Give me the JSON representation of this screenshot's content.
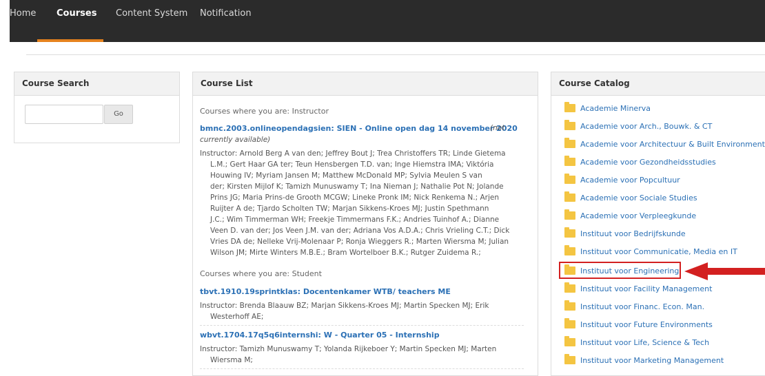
{
  "nav": {
    "items": [
      "Home",
      "Courses",
      "Content System",
      "Notification"
    ],
    "active": "Courses",
    "accent": "#e5821e"
  },
  "search_panel": {
    "title": "Course Search",
    "input_value": "",
    "go_label": "Go"
  },
  "course_list": {
    "title": "Course List",
    "instructor_label": "Courses where you are: Instructor",
    "student_label": "Courses where you are: Student",
    "instructor_courses": [
      {
        "title": "bmnc.2003.onlineopendagsien: SIEN - Online open dag 14 november 2020",
        "availability": "(not currently available)",
        "instructor_lines": [
          "Instructor: Arnold Berg A van den; Jeffrey Bout J; Trea Christoffers TR; Linde Gietema",
          "L.M.; Gert Haar GA ter; Teun Hensbergen T.D. van; Inge Hiemstra IMA; Viktória",
          "Houwing IV; Myriam Jansen M; Matthew McDonald MP; Sylvia Meulen S van",
          "der; Kirsten Mijlof K; Tamizh Munuswamy T; Ina Nieman J; Nathalie Pot N; Jolande",
          "Prins JG; Maria Prins-de Grooth MCGW; Lineke Pronk IM; Nick Renkema N.; Arjen",
          "Ruijter A de; Tjardo Scholten TW; Marjan Sikkens-Kroes MJ; Justin Spethmann",
          "J.C.; Wim Timmerman WH; Freekje Timmermans F.K.; Andries Tuinhof A.; Dianne",
          "Veen D. van der; Jos Veen J.M. van der; Adriana Vos A.D.A.; Chris Vrieling C.T.; Dick",
          "Vries DA de; Nelleke Vrij-Molenaar P; Ronja Wieggers R.; Marten Wiersma M; Julian",
          "Wilson JM; Mirte Winters M.B.E.; Bram Wortelboer B.K.; Rutger Zuidema R.;"
        ]
      }
    ],
    "student_courses": [
      {
        "title": "tbvt.1910.19sprintklas: Docentenkamer WTB/ teachers ME",
        "instructor_lines": [
          "Instructor: Brenda Blaauw BZ; Marjan Sikkens-Kroes MJ; Martin Specken MJ; Erik",
          "Westerhoff AE;"
        ]
      },
      {
        "title": "wbvt.1704.17q5q6internshi: W - Quarter 05 - Internship",
        "instructor_lines": [
          "Instructor: Tamizh Munuswamy T; Yolanda Rijkeboer Y; Martin Specken MJ; Marten",
          "Wiersma M;"
        ]
      }
    ]
  },
  "catalog": {
    "title": "Course Catalog",
    "items": [
      "Academie Minerva",
      "Academie voor Arch., Bouwk. & CT",
      "Academie voor Architectuur & Built Environment",
      "Academie voor Gezondheidsstudies",
      "Academie voor Popcultuur",
      "Academie voor Sociale Studies",
      "Academie voor Verpleegkunde",
      "Instituut voor Bedrijfskunde",
      "Instituut voor Communicatie, Media en IT",
      "Instituut voor Engineering",
      "Instituut voor Facility Management",
      "Instituut voor Financ. Econ. Man.",
      "Instituut voor Future Environments",
      "Instituut voor Life, Science & Tech",
      "Instituut voor Marketing Management"
    ],
    "highlighted": "Instituut voor Engineering",
    "highlight_color": "#d32020",
    "folder_color": "#f4c542"
  }
}
